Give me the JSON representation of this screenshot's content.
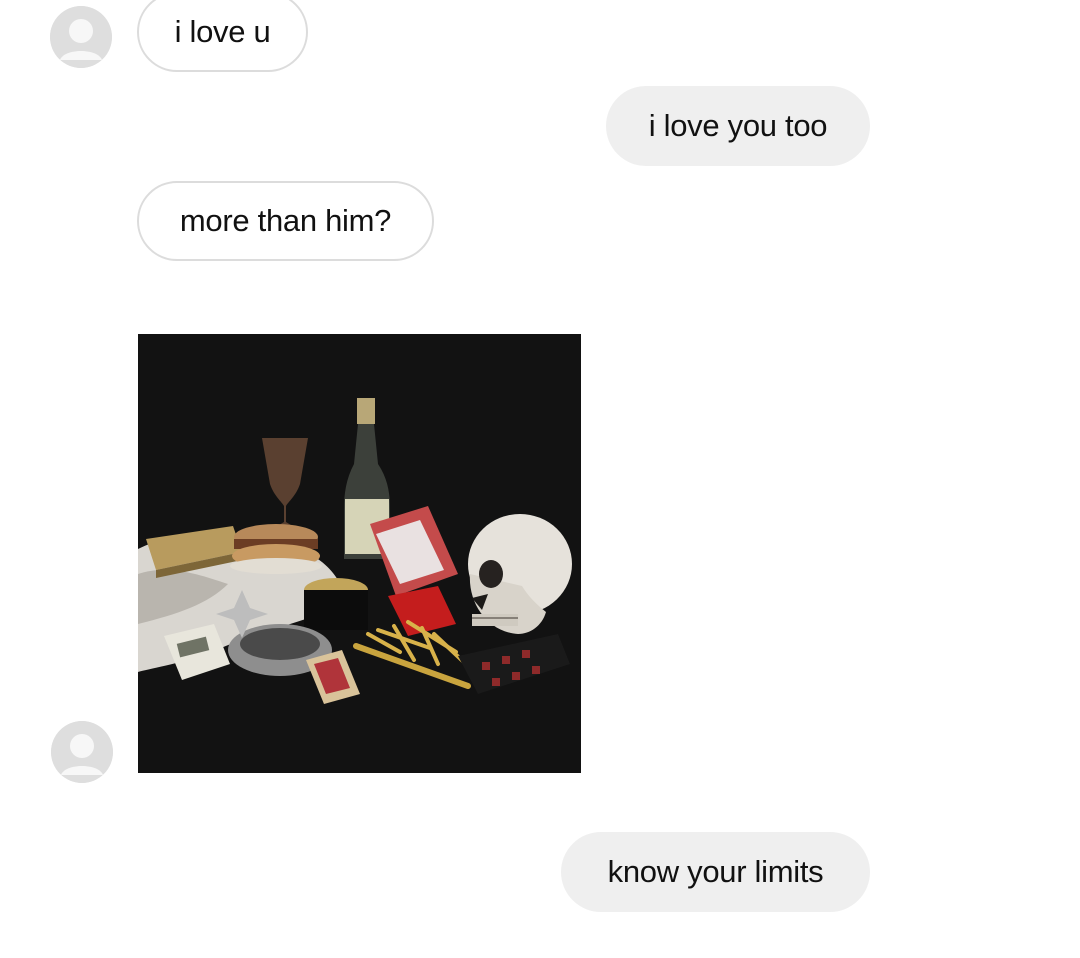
{
  "conversation": {
    "messages": [
      {
        "sender": "other",
        "text": "i love u"
      },
      {
        "sender": "me",
        "text": "i love you too"
      },
      {
        "sender": "other",
        "text": "more than him?"
      },
      {
        "sender": "other",
        "type": "photo",
        "icon": "still-life-skull-photo"
      },
      {
        "sender": "me",
        "text": "know your limits"
      }
    ]
  },
  "colors": {
    "sent_bubble": "#efefef",
    "received_bubble_border": "#dcdcdc",
    "avatar_bg": "#dedede",
    "photo_bg": "#121212"
  }
}
